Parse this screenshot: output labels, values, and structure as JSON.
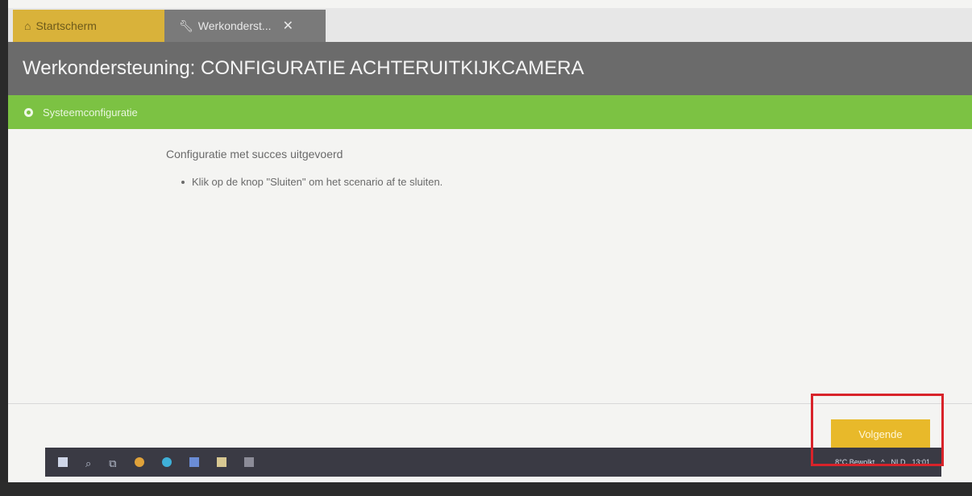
{
  "tabs": {
    "home_label": "Startscherm",
    "work_label": "Werkonderst...",
    "close_glyph": "✕"
  },
  "title": "Werkondersteuning: CONFIGURATIE ACHTERUITKIJKCAMERA",
  "step": {
    "label": "Systeemconfiguratie"
  },
  "content": {
    "message": "Configuratie met succes uitgevoerd",
    "bullet": "Klik op de knop \"Sluiten\" om het scenario af te sluiten."
  },
  "footer": {
    "next_label": "Volgende"
  },
  "taskbar": {
    "weather": "8°C Bewolkt",
    "language": "NLD",
    "time": "13:01"
  },
  "colors": {
    "home_tab": "#d9b23a",
    "title_bar": "#6b6b6b",
    "step_bar": "#7cc243",
    "next_button": "#e8b92a",
    "highlight": "#d8232a"
  }
}
